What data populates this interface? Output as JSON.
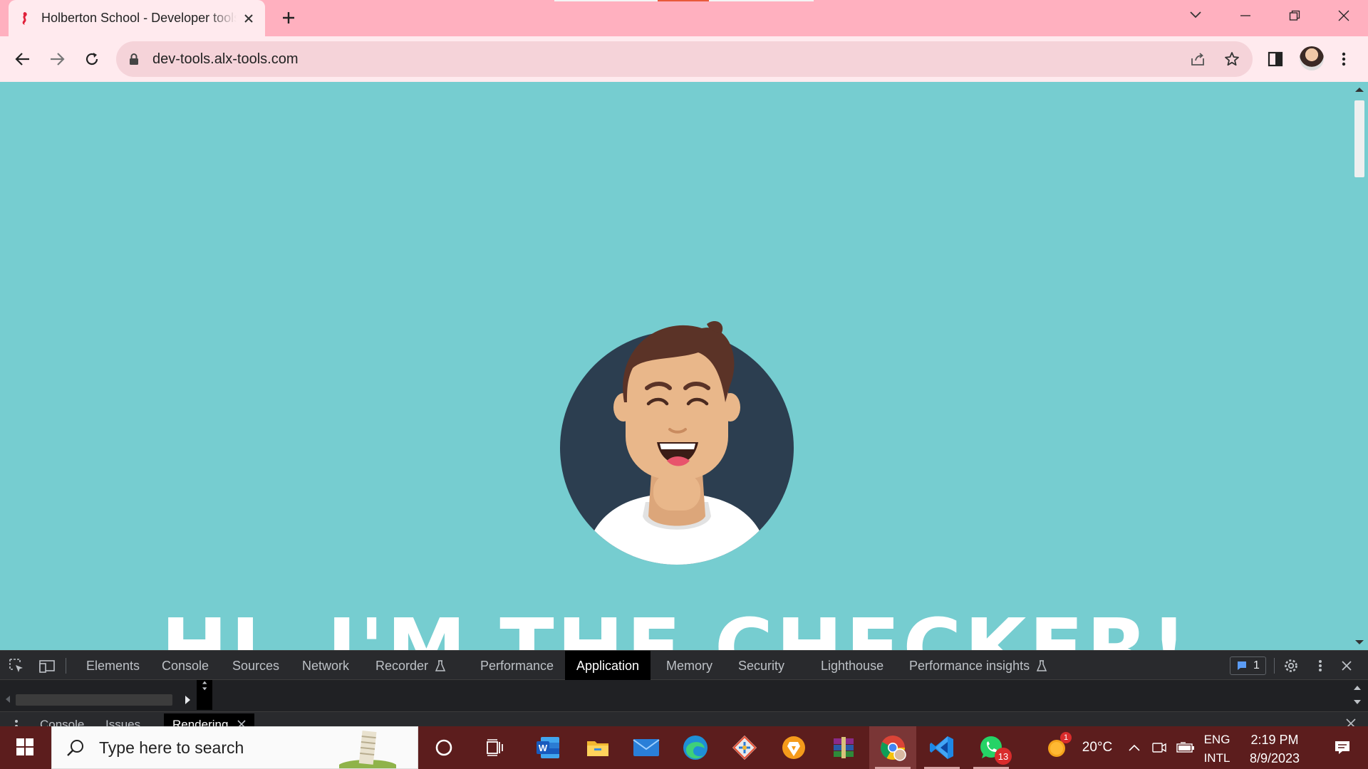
{
  "browser": {
    "tab": {
      "title": "Holberton School - Developer tools",
      "favicon": "holberton-seahorse-icon"
    },
    "new_tab_icon": "plus-icon",
    "address": {
      "url": "dev-tools.alx-tools.com"
    },
    "colors": {
      "tabstrip": "#ffb0bf",
      "toolbar": "#ffeaee",
      "omnibox": "#f5d3d9"
    }
  },
  "page": {
    "background": "#76cdd0",
    "headline": "HI, I'M THE CHECKER!"
  },
  "devtools": {
    "tabs": [
      {
        "label": "Elements"
      },
      {
        "label": "Console"
      },
      {
        "label": "Sources"
      },
      {
        "label": "Network"
      },
      {
        "label": "Recorder"
      },
      {
        "label": "Performance"
      },
      {
        "label": "Application"
      },
      {
        "label": "Memory"
      },
      {
        "label": "Security"
      },
      {
        "label": "Lighthouse"
      },
      {
        "label": "Performance insights"
      }
    ],
    "active_tab": "Application",
    "issues_count": "1",
    "drawer_tabs": [
      {
        "label": "Console"
      },
      {
        "label": "Issues"
      },
      {
        "label": "Rendering"
      }
    ],
    "active_drawer_tab": "Rendering"
  },
  "taskbar": {
    "search_placeholder": "Type here to search",
    "apps": [
      "cortana-icon",
      "task-view-icon",
      "word-icon",
      "file-explorer-icon",
      "mail-icon",
      "edge-icon",
      "git-icon",
      "brave-icon",
      "winrar-icon",
      "chrome-icon",
      "vscode-icon",
      "whatsapp-icon"
    ],
    "whatsapp_badge": "13",
    "weather": {
      "temp": "20°C",
      "badge": "1"
    },
    "language": {
      "line1": "ENG",
      "line2": "INTL"
    },
    "clock": {
      "time": "2:19 PM",
      "date": "8/9/2023"
    }
  }
}
